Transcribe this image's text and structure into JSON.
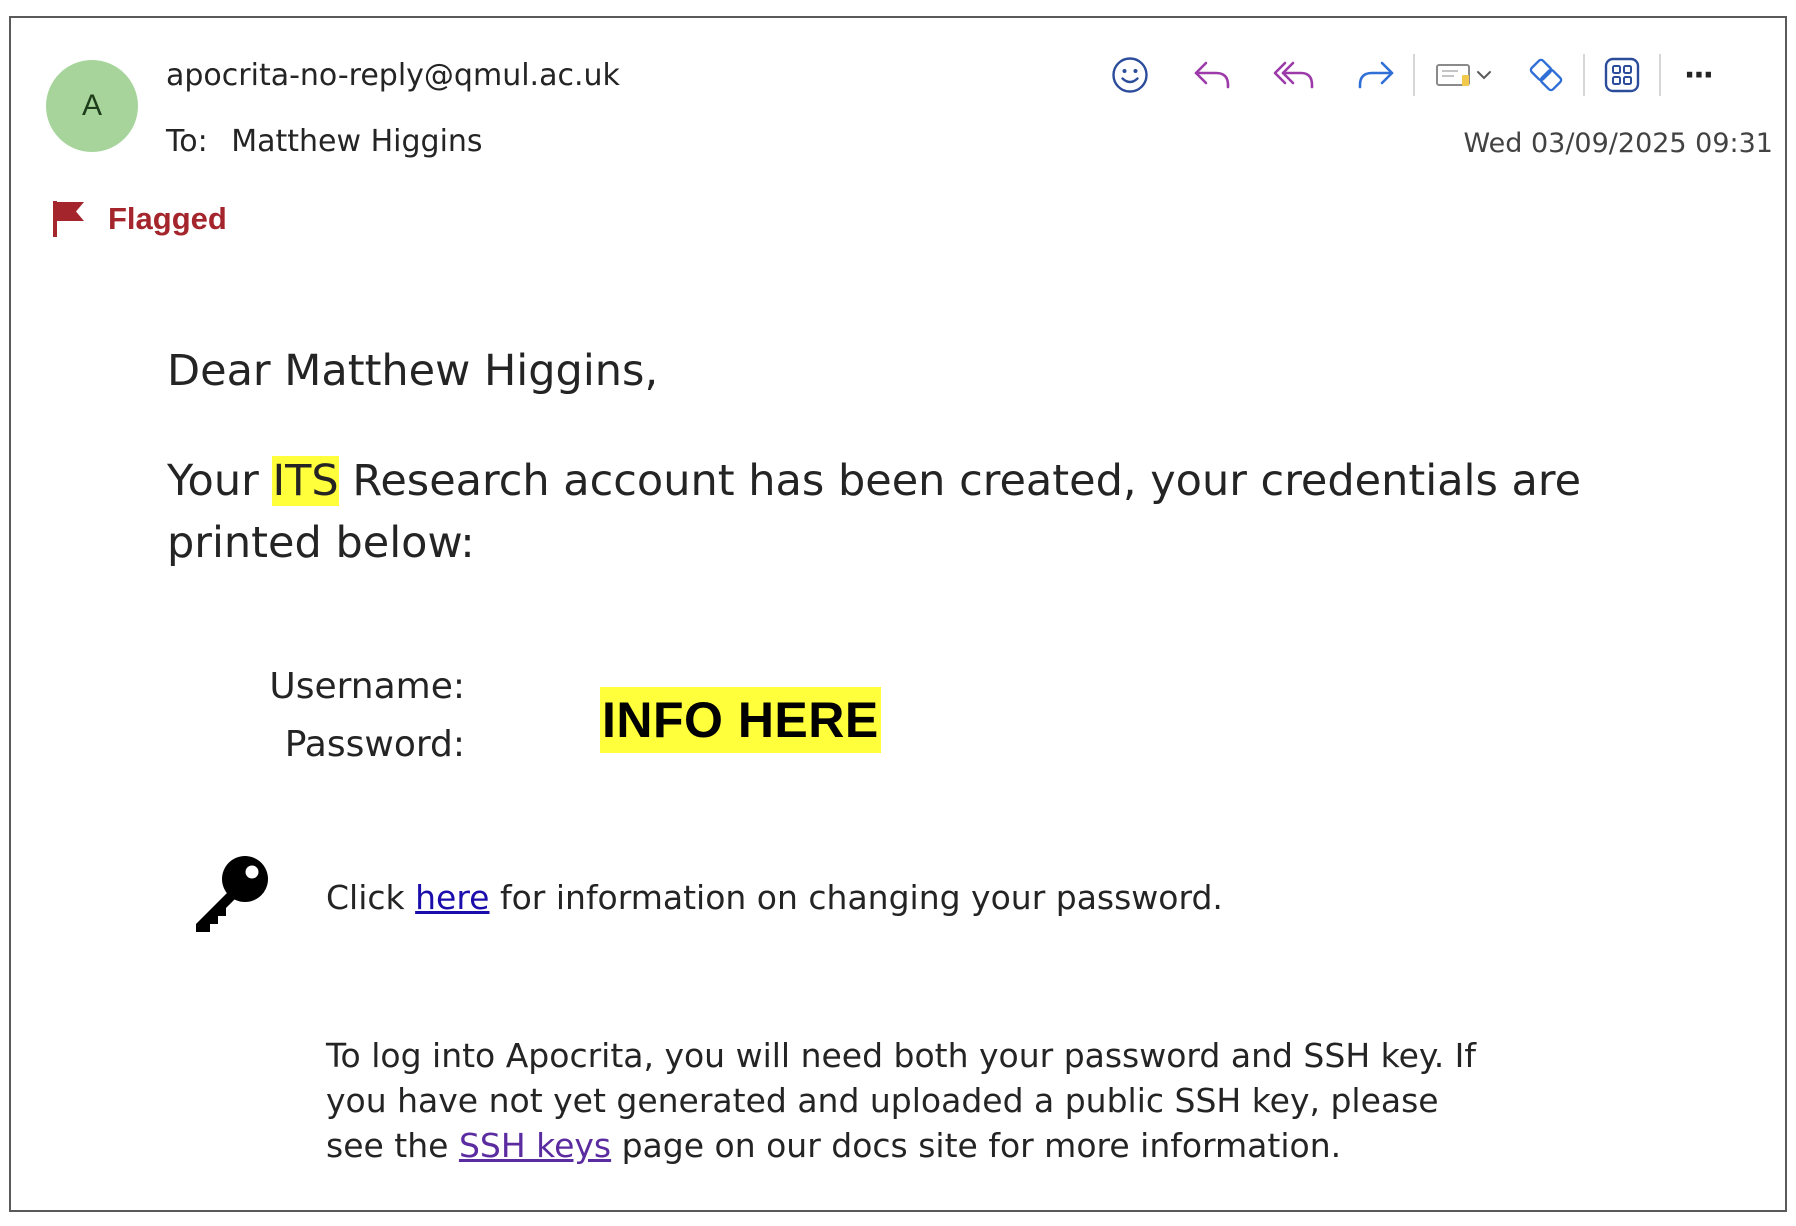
{
  "header": {
    "avatar_initial": "A",
    "sender": "apocrita-no-reply@qmul.ac.uk",
    "to_label": "To:",
    "to_name": "Matthew Higgins",
    "date": "Wed 03/09/2025 09:31",
    "flag_label": "Flagged",
    "flag_color": "#a4262c"
  },
  "toolbar": {
    "icons": [
      "emoji-icon",
      "reply-icon",
      "reply-all-icon",
      "forward-icon",
      "move-to-icon",
      "chevron-down-icon",
      "immersive-reader-icon",
      "apps-icon",
      "more-icon"
    ],
    "more_label": "···"
  },
  "email": {
    "greeting": "Dear Matthew Higgins,",
    "para1_before": "Your ",
    "para1_highlight": "ITS",
    "para1_after": " Research account has been created, your credentials are printed below:",
    "username_label": "Username:",
    "password_label": "Password:",
    "credentials_placeholder": "INFO HERE",
    "click_before": "Click ",
    "click_link": "here",
    "click_after": " for information on changing your password.",
    "para2_before": "To log into Apocrita, you will need both your password and SSH key. If you have not yet generated and uploaded a public SSH key, please see the ",
    "para2_link": "SSH keys",
    "para2_after": " page on our docs site for more information.",
    "highlight_color": "#ffff3b",
    "link_color": "#1a0dab"
  }
}
